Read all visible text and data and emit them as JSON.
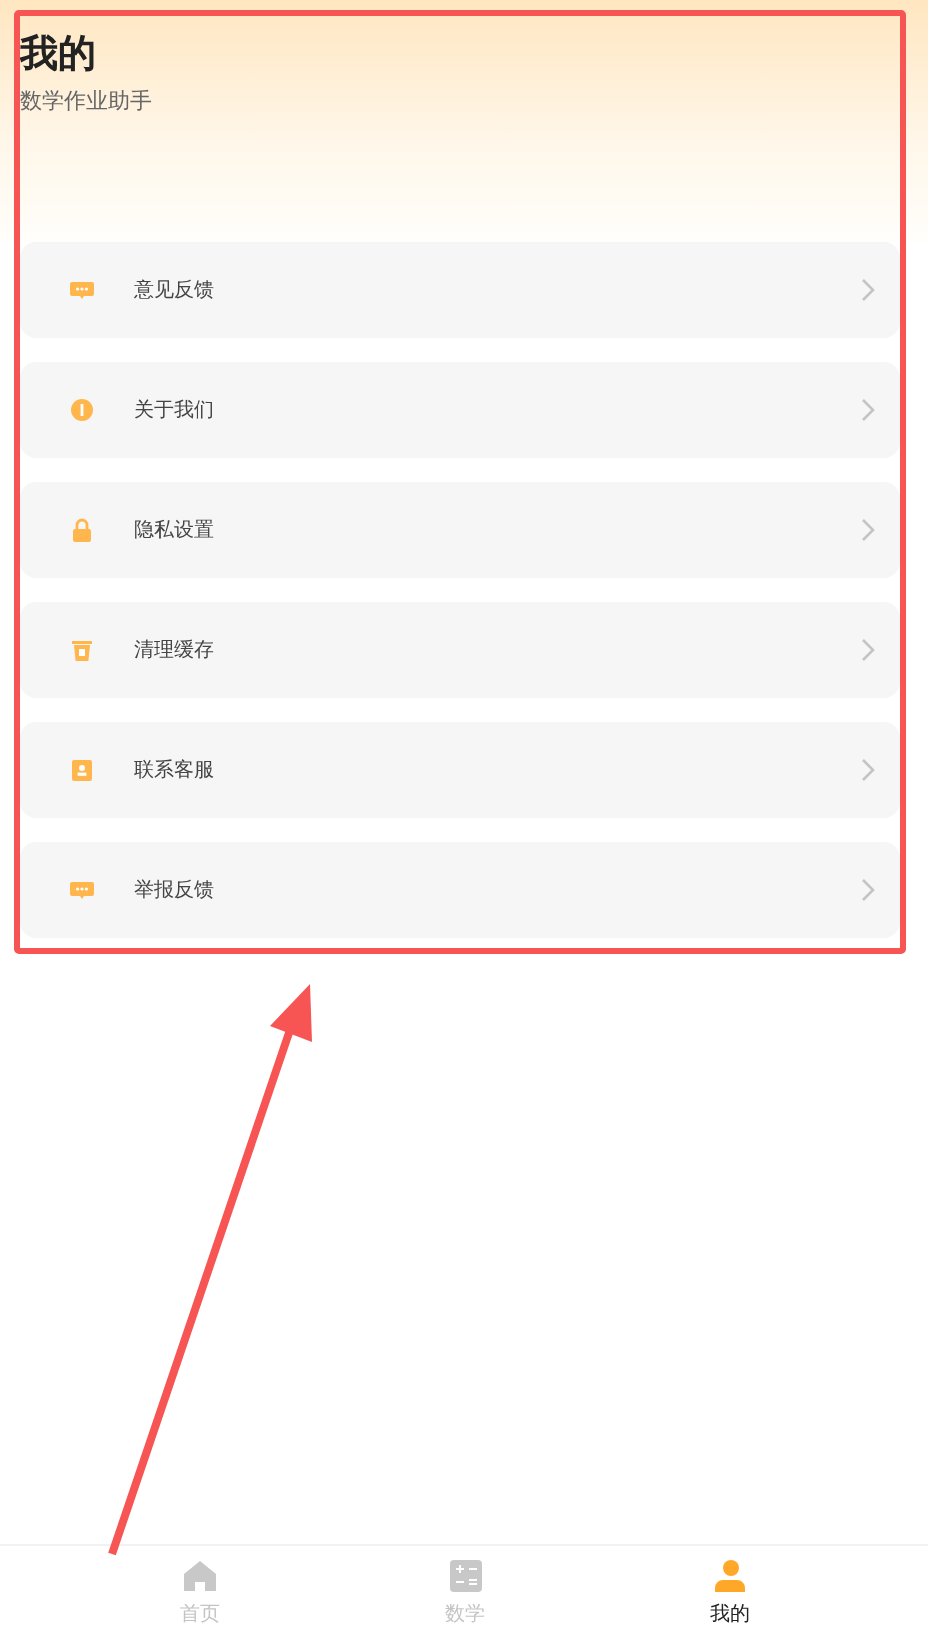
{
  "header": {
    "title": "我的",
    "subtitle": "数学作业助手"
  },
  "menu": [
    {
      "label": "意见反馈",
      "kind": "chat"
    },
    {
      "label": "关于我们",
      "kind": "info"
    },
    {
      "label": "隐私设置",
      "kind": "lock"
    },
    {
      "label": "清理缓存",
      "kind": "trash"
    },
    {
      "label": "联系客服",
      "kind": "contact"
    },
    {
      "label": "举报反馈",
      "kind": "chat"
    }
  ],
  "tab_bar": [
    {
      "label": "首页",
      "kind": "home",
      "selected": false
    },
    {
      "label": "数学",
      "kind": "calc",
      "selected": false
    },
    {
      "label": "我的",
      "kind": "user",
      "selected": true
    }
  ]
}
